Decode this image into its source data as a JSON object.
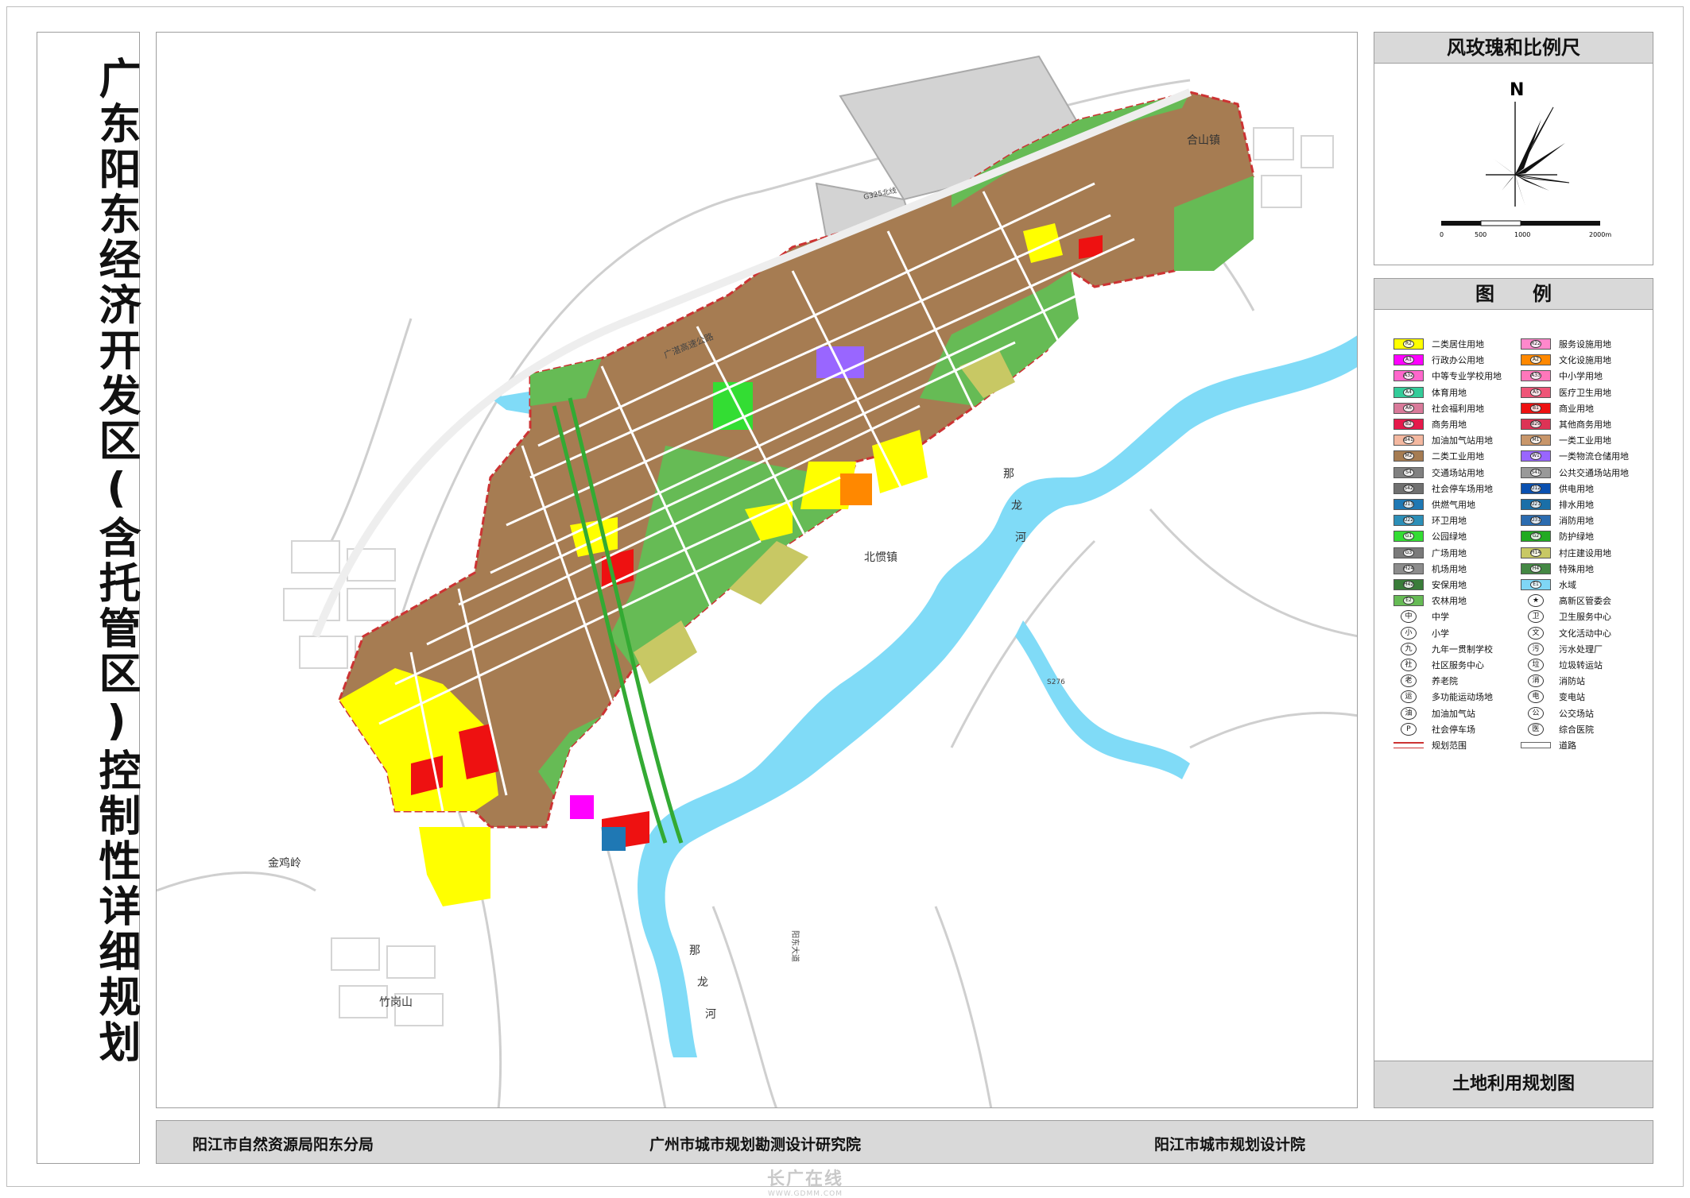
{
  "title": "广东阳东经济开发区(含托管区)控制性详细规划",
  "compass_panel": {
    "header": "风玫瑰和比例尺",
    "north_label": "N",
    "scale_labels": [
      "0",
      "500",
      "1000",
      "2000m"
    ]
  },
  "legend_panel": {
    "header": "图　　例",
    "footer": "土地利用规划图",
    "items_left": [
      {
        "label": "二类居住用地",
        "color": "#ffff00",
        "code": "R2"
      },
      {
        "label": "行政办公用地",
        "color": "#ff00ff",
        "code": "A1"
      },
      {
        "label": "中等专业学校用地",
        "color": "#ff66cc",
        "code": "A32"
      },
      {
        "label": "体育用地",
        "color": "#33cc99",
        "code": "A4"
      },
      {
        "label": "社会福利用地",
        "color": "#d97a9a",
        "code": "A6"
      },
      {
        "label": "商务用地",
        "color": "#e6194b",
        "code": "B2"
      },
      {
        "label": "加油加气站用地",
        "color": "#f4b8a0",
        "code": "B41"
      },
      {
        "label": "二类工业用地",
        "color": "#a67c52",
        "code": "M2"
      },
      {
        "label": "交通场站用地",
        "color": "#808080",
        "code": "S4"
      },
      {
        "label": "社会停车场用地",
        "color": "#707070",
        "code": "S42"
      },
      {
        "label": "供燃气用地",
        "color": "#1f78b4",
        "code": "U13"
      },
      {
        "label": "环卫用地",
        "color": "#2c8fb8",
        "code": "U22"
      },
      {
        "label": "公园绿地",
        "color": "#33dd33",
        "code": "G1"
      },
      {
        "label": "广场用地",
        "color": "#7a7a7a",
        "code": "G3"
      },
      {
        "label": "机场用地",
        "color": "#8c8c8c",
        "code": "H24"
      },
      {
        "label": "安保用地",
        "color": "#3a7d3a",
        "code": "H42"
      },
      {
        "label": "农林用地",
        "color": "#66bb55",
        "code": "E2"
      },
      {
        "label": "中学",
        "symbol": "中"
      },
      {
        "label": "小学",
        "symbol": "小"
      },
      {
        "label": "九年一贯制学校",
        "symbol": "九"
      },
      {
        "label": "社区服务中心",
        "symbol": "社"
      },
      {
        "label": "养老院",
        "symbol": "老"
      },
      {
        "label": "多功能运动场地",
        "symbol": "运"
      },
      {
        "label": "加油加气站",
        "symbol": "油"
      },
      {
        "label": "社会停车场",
        "symbol": "P"
      },
      {
        "label": "规划范围",
        "line": "boundary"
      }
    ],
    "items_right": [
      {
        "label": "服务设施用地",
        "color": "#ff88cc",
        "code": "R22"
      },
      {
        "label": "文化设施用地",
        "color": "#ff8800",
        "code": "A2"
      },
      {
        "label": "中小学用地",
        "color": "#ff77bb",
        "code": "A33"
      },
      {
        "label": "医疗卫生用地",
        "color": "#ee5577",
        "code": "A5"
      },
      {
        "label": "商业用地",
        "color": "#ee1111",
        "code": "B1"
      },
      {
        "label": "其他商务用地",
        "color": "#dd3355",
        "code": "B29"
      },
      {
        "label": "一类工业用地",
        "color": "#c8966a",
        "code": "M1"
      },
      {
        "label": "一类物流仓储用地",
        "color": "#9966ff",
        "code": "W1"
      },
      {
        "label": "公共交通场站用地",
        "color": "#999999",
        "code": "S41"
      },
      {
        "label": "供电用地",
        "color": "#0a50b0",
        "code": "U12"
      },
      {
        "label": "排水用地",
        "color": "#1a6fa8",
        "code": "U21"
      },
      {
        "label": "消防用地",
        "color": "#2b6cb0",
        "code": "U31"
      },
      {
        "label": "防护绿地",
        "color": "#22aa22",
        "code": "G2"
      },
      {
        "label": "村庄建设用地",
        "color": "#c8c864",
        "code": "H14"
      },
      {
        "label": "特殊用地",
        "color": "#448844",
        "code": "H4"
      },
      {
        "label": "水域",
        "color": "#7fd6f5",
        "code": "E1"
      },
      {
        "label": "高新区管委会",
        "symbol": "★"
      },
      {
        "label": "卫生服务中心",
        "symbol": "卫"
      },
      {
        "label": "文化活动中心",
        "symbol": "文"
      },
      {
        "label": "污水处理厂",
        "symbol": "污"
      },
      {
        "label": "垃圾转运站",
        "symbol": "垃"
      },
      {
        "label": "消防站",
        "symbol": "消"
      },
      {
        "label": "变电站",
        "symbol": "电"
      },
      {
        "label": "公交场站",
        "symbol": "公"
      },
      {
        "label": "综合医院",
        "symbol": "医"
      },
      {
        "label": "道路",
        "line": "road"
      }
    ]
  },
  "map_labels": {
    "hexin": "合山镇",
    "beiguan": "北惯镇",
    "jinjiling": "金鸡岭",
    "zhugangshan": "竹岗山",
    "nalong_river": [
      "那",
      "龙",
      "河"
    ],
    "nalong_river2": [
      "那",
      "龙",
      "河"
    ],
    "highway_guangzhan": "广湛高速公路",
    "highway_g325": "G325北线",
    "road_s276": "S276",
    "road_yangdong": "阳东大道"
  },
  "footer": {
    "org1": "阳江市自然资源局阳东分局",
    "org2": "广州市城市规划勘测设计研究院",
    "org3": "阳江市城市规划设计院"
  },
  "watermark": {
    "text": "长广在线",
    "url": "WWW.GDMM.COM"
  }
}
